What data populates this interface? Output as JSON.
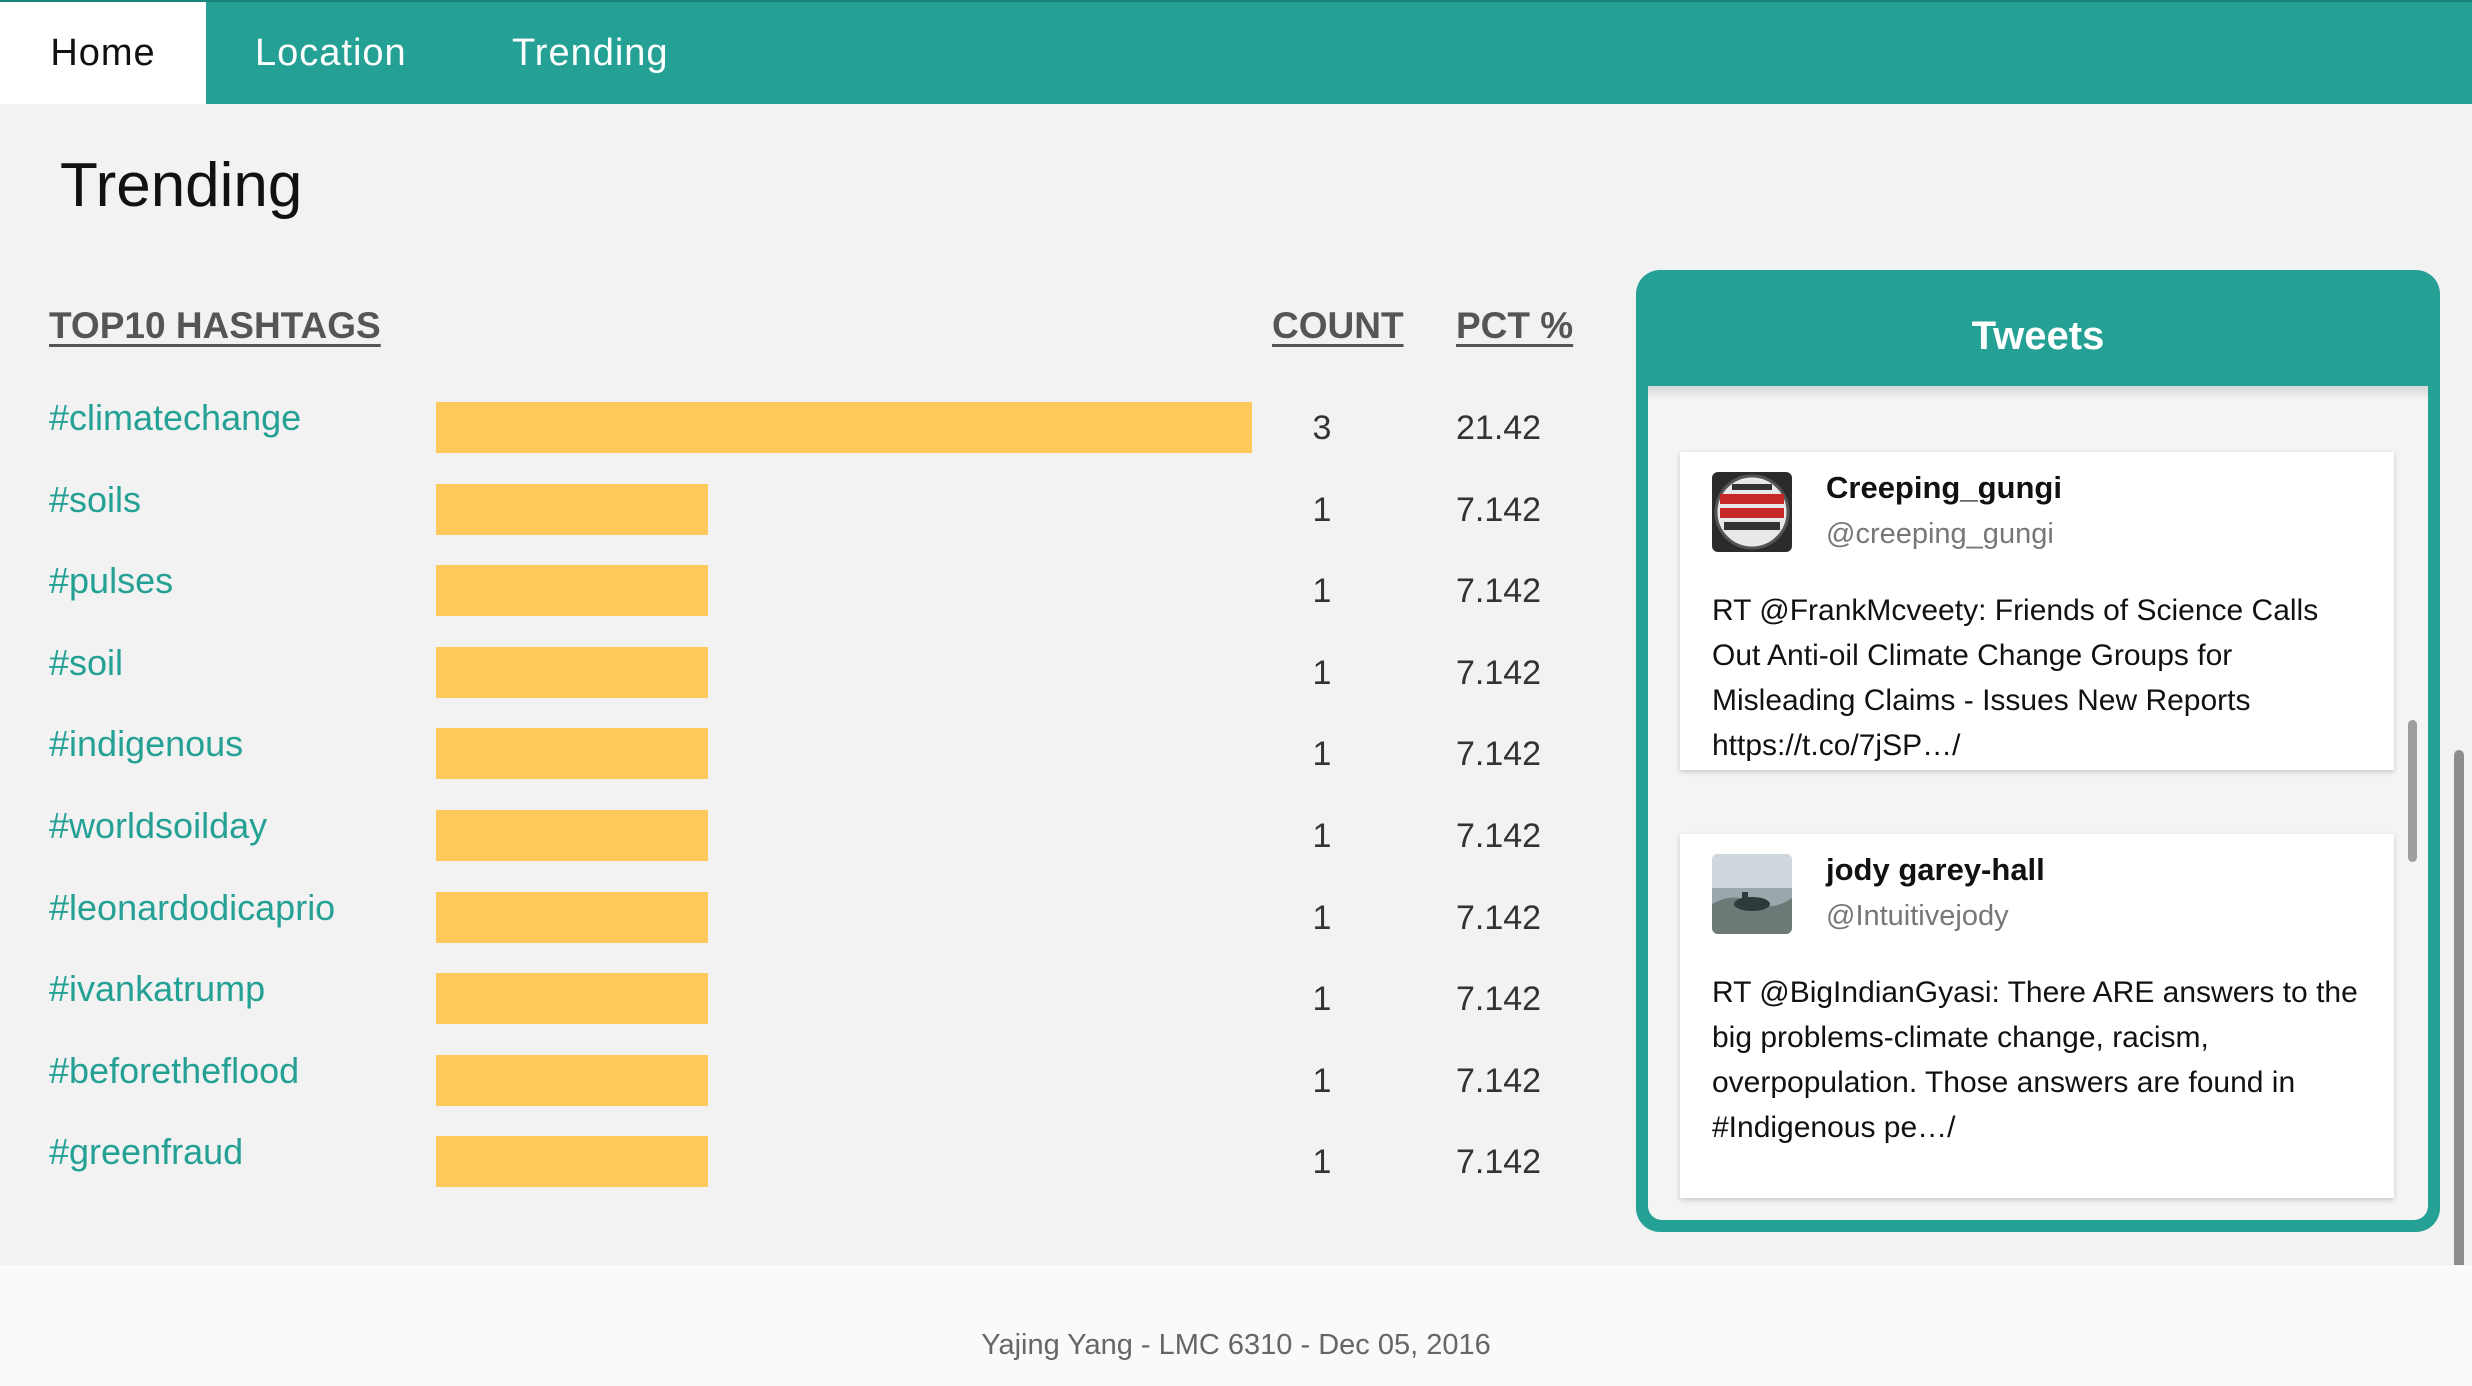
{
  "nav": {
    "items": [
      {
        "label": "Home"
      },
      {
        "label": "Location"
      },
      {
        "label": "Trending"
      }
    ]
  },
  "page": {
    "title": "Trending"
  },
  "table": {
    "headers": {
      "hashtags": "TOP10 HASHTAGS",
      "count": "COUNT",
      "pct": "PCT %"
    },
    "rows": [
      {
        "tag": "#climatechange",
        "count": "3",
        "pct": "21.42"
      },
      {
        "tag": "#soils",
        "count": "1",
        "pct": "7.142"
      },
      {
        "tag": "#pulses",
        "count": "1",
        "pct": "7.142"
      },
      {
        "tag": "#soil",
        "count": "1",
        "pct": "7.142"
      },
      {
        "tag": "#indigenous",
        "count": "1",
        "pct": "7.142"
      },
      {
        "tag": "#worldsoilday",
        "count": "1",
        "pct": "7.142"
      },
      {
        "tag": "#leonardodicaprio",
        "count": "1",
        "pct": "7.142"
      },
      {
        "tag": "#ivankatrump",
        "count": "1",
        "pct": "7.142"
      },
      {
        "tag": "#beforetheflood",
        "count": "1",
        "pct": "7.142"
      },
      {
        "tag": "#greenfraud",
        "count": "1",
        "pct": "7.142"
      }
    ]
  },
  "chart_data": {
    "type": "bar",
    "categories": [
      "#climatechange",
      "#soils",
      "#pulses",
      "#soil",
      "#indigenous",
      "#worldsoilday",
      "#leonardodicaprio",
      "#ivankatrump",
      "#beforetheflood",
      "#greenfraud"
    ],
    "values": [
      3,
      1,
      1,
      1,
      1,
      1,
      1,
      1,
      1,
      1
    ],
    "title": "TOP10 HASHTAGS",
    "orientation": "horizontal",
    "bar_color": "#fcc95a"
  },
  "tweets": {
    "title": "Tweets",
    "items": [
      {
        "name": "Creeping_gungi",
        "handle": "@creeping_gungi",
        "text": "RT @FrankMcveety: Friends of Science Calls Out Anti-oil Climate Change Groups for Misleading Claims - Issues New Reports https://t.co/7jSP…/",
        "avatar_icon": "avatar-badge"
      },
      {
        "name": "jody garey-hall",
        "handle": "@Intuitivejody",
        "text": "RT @BigIndianGyasi: There ARE answers to the big problems-climate change, racism, overpopulation. Those answers are found in #Indigenous pe…/",
        "avatar_icon": "avatar-photo"
      }
    ]
  },
  "footer": {
    "text": "Yajing Yang - LMC 6310 - Dec 05, 2016"
  },
  "colors": {
    "accent": "#24a194",
    "bar": "#fcc95a",
    "background": "#f2f2f2"
  }
}
